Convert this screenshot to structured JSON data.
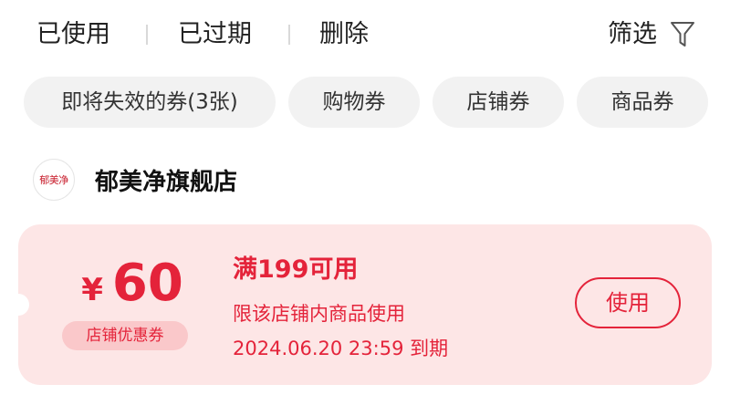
{
  "topbar": {
    "actions": [
      "已使用",
      "已过期",
      "删除"
    ],
    "filter_label": "筛选",
    "filter_icon": "filter-icon"
  },
  "chips": [
    "即将失效的券(3张)",
    "购物券",
    "店铺券",
    "商品券"
  ],
  "shop": {
    "logo_text": "郁美净",
    "name": "郁美净旗舰店"
  },
  "coupon": {
    "currency": "¥",
    "amount": "60",
    "type": "店铺优惠券",
    "condition": "满199可用",
    "scope": "限该店铺内商品使用",
    "expiry": "2024.06.20 23:59 到期",
    "use_label": "使用"
  },
  "colors": {
    "accent": "#e4233a",
    "coupon_bg": "#fde6e6",
    "chip_bg": "#f2f2f2"
  }
}
